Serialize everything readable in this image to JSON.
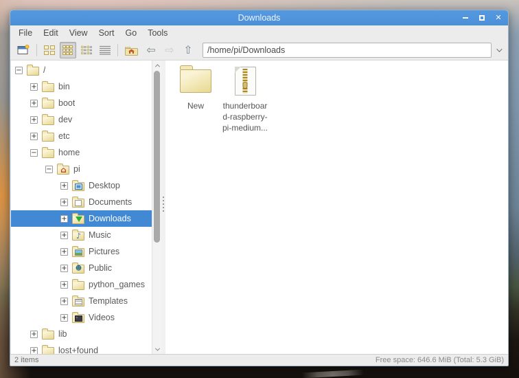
{
  "window": {
    "title": "Downloads"
  },
  "window_controls": {
    "minimize": "–",
    "maximize": "□",
    "close": "✕"
  },
  "menu_bar": {
    "items": [
      "File",
      "Edit",
      "View",
      "Sort",
      "Go",
      "Tools"
    ]
  },
  "toolbar": {
    "path_value": "/home/pi/Downloads",
    "back_glyph": "⇦",
    "forward_glyph": "⇨",
    "up_glyph": "⇧",
    "button_names": [
      "new-tab",
      "icon-view",
      "thumbnail-view",
      "compact-view",
      "detailed-list-view",
      "home",
      "back",
      "forward",
      "up",
      "path-entry",
      "path-dropdown"
    ]
  },
  "tree": {
    "items": [
      {
        "label": "/",
        "expander": "−",
        "icon": "folder",
        "level": 0,
        "selected": false
      },
      {
        "label": "bin",
        "expander": "+",
        "icon": "folder",
        "level": 1,
        "selected": false
      },
      {
        "label": "boot",
        "expander": "+",
        "icon": "folder",
        "level": 1,
        "selected": false
      },
      {
        "label": "dev",
        "expander": "+",
        "icon": "folder",
        "level": 1,
        "selected": false
      },
      {
        "label": "etc",
        "expander": "+",
        "icon": "folder",
        "level": 1,
        "selected": false
      },
      {
        "label": "home",
        "expander": "−",
        "icon": "folder",
        "level": 1,
        "selected": false
      },
      {
        "label": "pi",
        "expander": "−",
        "icon": "folder-home",
        "level": 2,
        "selected": false
      },
      {
        "label": "Desktop",
        "expander": "+",
        "icon": "folder-desktop",
        "level": 3,
        "selected": false
      },
      {
        "label": "Documents",
        "expander": "+",
        "icon": "folder-documents",
        "level": 3,
        "selected": false
      },
      {
        "label": "Downloads",
        "expander": "+",
        "icon": "folder-downloads",
        "level": 3,
        "selected": true
      },
      {
        "label": "Music",
        "expander": "+",
        "icon": "folder-music",
        "level": 3,
        "selected": false
      },
      {
        "label": "Pictures",
        "expander": "+",
        "icon": "folder-pictures",
        "level": 3,
        "selected": false
      },
      {
        "label": "Public",
        "expander": "+",
        "icon": "folder-public",
        "level": 3,
        "selected": false
      },
      {
        "label": "python_games",
        "expander": "+",
        "icon": "folder",
        "level": 3,
        "selected": false
      },
      {
        "label": "Templates",
        "expander": "+",
        "icon": "folder-templates",
        "level": 3,
        "selected": false
      },
      {
        "label": "Videos",
        "expander": "+",
        "icon": "folder-videos",
        "level": 3,
        "selected": false
      },
      {
        "label": "lib",
        "expander": "+",
        "icon": "folder",
        "level": 1,
        "selected": false
      },
      {
        "label": "lost+found",
        "expander": "+",
        "icon": "folder",
        "level": 1,
        "selected": false
      }
    ]
  },
  "files": {
    "items": [
      {
        "label": "New",
        "icon": "folder"
      },
      {
        "label_lines": [
          "thunderboar",
          "d-raspberry-",
          "pi-medium..."
        ],
        "icon": "zip-archive"
      }
    ]
  },
  "status_bar": {
    "left": "2 items",
    "right": "Free space: 646.6 MiB (Total: 5.3 GiB)"
  },
  "colors": {
    "titlebar": "#4a90d9",
    "selection": "#4289d5",
    "window_bg": "#ececec",
    "folder_body": "#eadc98",
    "folder_border": "#c0ab6d",
    "downloads_arrow": "#2dad2d"
  }
}
